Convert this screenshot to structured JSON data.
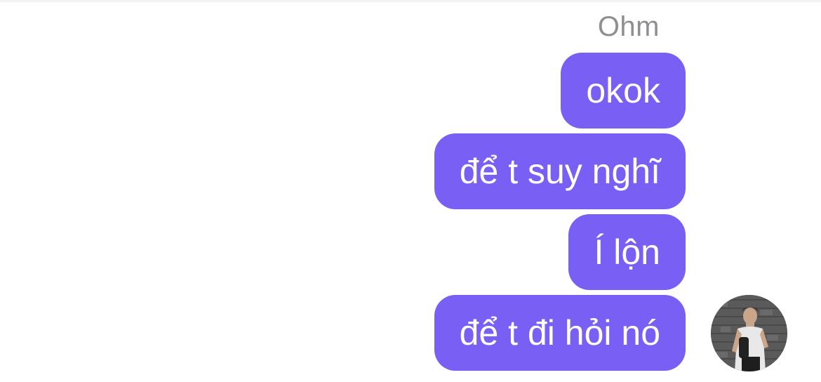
{
  "chat": {
    "sender_name": "Ohm",
    "messages": [
      {
        "text": "okok"
      },
      {
        "text": "để t suy nghĩ"
      },
      {
        "text": "Í lộn"
      },
      {
        "text": "để t đi hỏi nó"
      }
    ],
    "bubble_color": "#7a5ff5",
    "text_color": "#ffffff",
    "avatar_icon": "user-photo-avatar"
  }
}
